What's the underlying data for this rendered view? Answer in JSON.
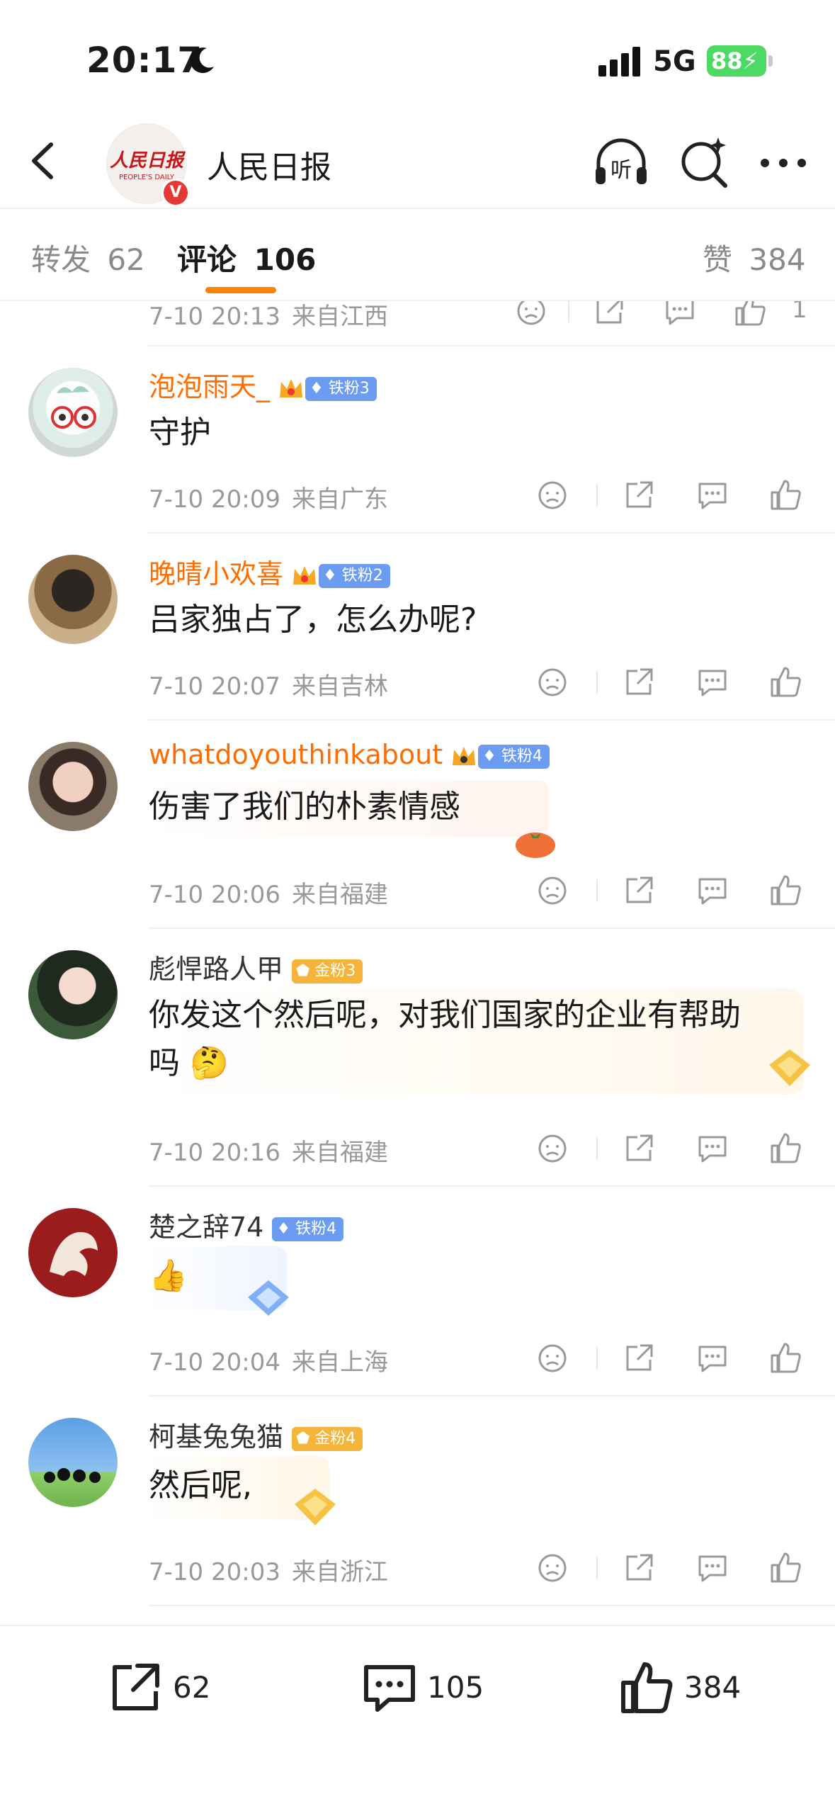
{
  "status_bar": {
    "time": "20:17",
    "network": "5G",
    "battery": "88"
  },
  "nav": {
    "title": "人民日报",
    "logo_text": "人民日报",
    "logo_sub": "PEOPLE'S DAILY",
    "verified": "V"
  },
  "tabs": [
    {
      "label": "转发",
      "count": "62"
    },
    {
      "label": "评论",
      "count": "106",
      "active": true
    },
    {
      "label": "赞",
      "count": "384"
    }
  ],
  "partial_row": {
    "time": "7-10 20:13",
    "location": "来自江西",
    "likes": "1"
  },
  "comments": [
    {
      "user": "泡泡雨天_",
      "badge": "铁粉3",
      "badge_type": "iron",
      "crown": true,
      "text": "守护",
      "time": "7-10 20:09",
      "location": "来自广东"
    },
    {
      "user": "晚晴小欢喜",
      "badge": "铁粉2",
      "badge_type": "iron",
      "crown": true,
      "text": "吕家独占了，怎么办呢?",
      "time": "7-10 20:07",
      "location": "来自吉林"
    },
    {
      "user": "whatdoyouthinkabout",
      "badge": "铁粉4",
      "badge_type": "iron",
      "crown": true,
      "text": "伤害了我们的朴素情感",
      "time": "7-10 20:06",
      "location": "来自福建"
    },
    {
      "user": "彪悍路人甲",
      "badge": "金粉3",
      "badge_type": "gold",
      "crown": false,
      "text_line1": "你发这个然后呢，对我们国家的企业有帮助",
      "text_line2": "吗",
      "time": "7-10 20:16",
      "location": "来自福建"
    },
    {
      "user": "楚之辞74",
      "badge": "铁粉4",
      "badge_type": "iron",
      "crown": false,
      "text": "👍",
      "time": "7-10 20:04",
      "location": "来自上海"
    },
    {
      "user": "柯基兔兔猫",
      "badge": "金粉4",
      "badge_type": "gold",
      "crown": false,
      "text": "然后呢,",
      "time": "7-10 20:03",
      "location": "来自浙江"
    }
  ],
  "bottom_bar": {
    "repost_count": "62",
    "comment_count": "105",
    "like_count": "384"
  },
  "colors": {
    "accent": "#ff8200",
    "username": "#ff6d00",
    "iron_badge": "#6b9cf2",
    "gold_badge": "#f5b43a",
    "meta": "#999999"
  }
}
